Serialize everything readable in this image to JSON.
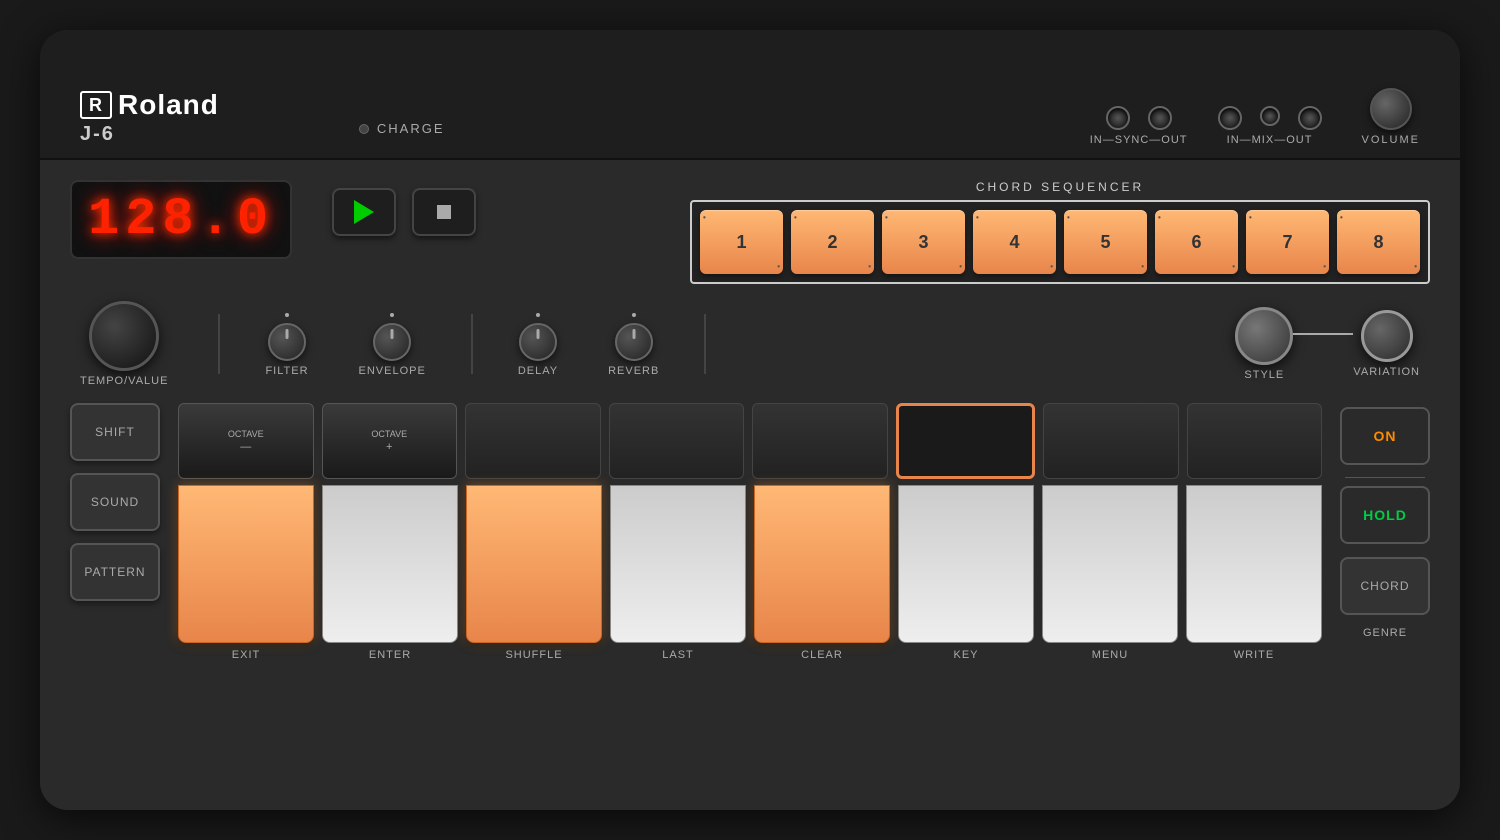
{
  "brand": {
    "logo": "Roland",
    "model": "J-6"
  },
  "topbar": {
    "charge_label": "CHARGE",
    "connector_labels": {
      "sync": "IN—SYNC—OUT",
      "mix": "IN—MIX—OUT",
      "volume": "VOLUME"
    }
  },
  "display": {
    "value": "128.0"
  },
  "transport": {
    "play_label": "play",
    "stop_label": "stop"
  },
  "chord_sequencer": {
    "title": "CHORD SEQUENCER",
    "buttons": [
      {
        "id": 1,
        "label": "1"
      },
      {
        "id": 2,
        "label": "2"
      },
      {
        "id": 3,
        "label": "3"
      },
      {
        "id": 4,
        "label": "4"
      },
      {
        "id": 5,
        "label": "5"
      },
      {
        "id": 6,
        "label": "6"
      },
      {
        "id": 7,
        "label": "7"
      },
      {
        "id": 8,
        "label": "8"
      }
    ]
  },
  "knobs": {
    "filter_label": "FILTER",
    "envelope_label": "ENVELOPE",
    "delay_label": "DELAY",
    "reverb_label": "REVERB",
    "style_label": "STYLE",
    "variation_label": "VARIATION",
    "tempo_label": "TEMPO/VALUE"
  },
  "keys": {
    "bottom_labels": [
      "EXIT",
      "ENTER",
      "SHUFFLE",
      "LAST",
      "CLEAR",
      "KEY",
      "MENU",
      "WRITE"
    ],
    "octave_minus": "OCTAVE\n—",
    "octave_plus": "OCTAVE\n+"
  },
  "side_buttons": {
    "shift": "SHIFT",
    "sound": "SOUND",
    "pattern": "PATTERN"
  },
  "right_buttons": {
    "on": "ON",
    "hold": "HOLD",
    "chord": "CHORD",
    "genre": "GENRE"
  },
  "lit_keys": {
    "white_lit": [
      0,
      2,
      4
    ],
    "white_orange_border": [
      5
    ]
  }
}
